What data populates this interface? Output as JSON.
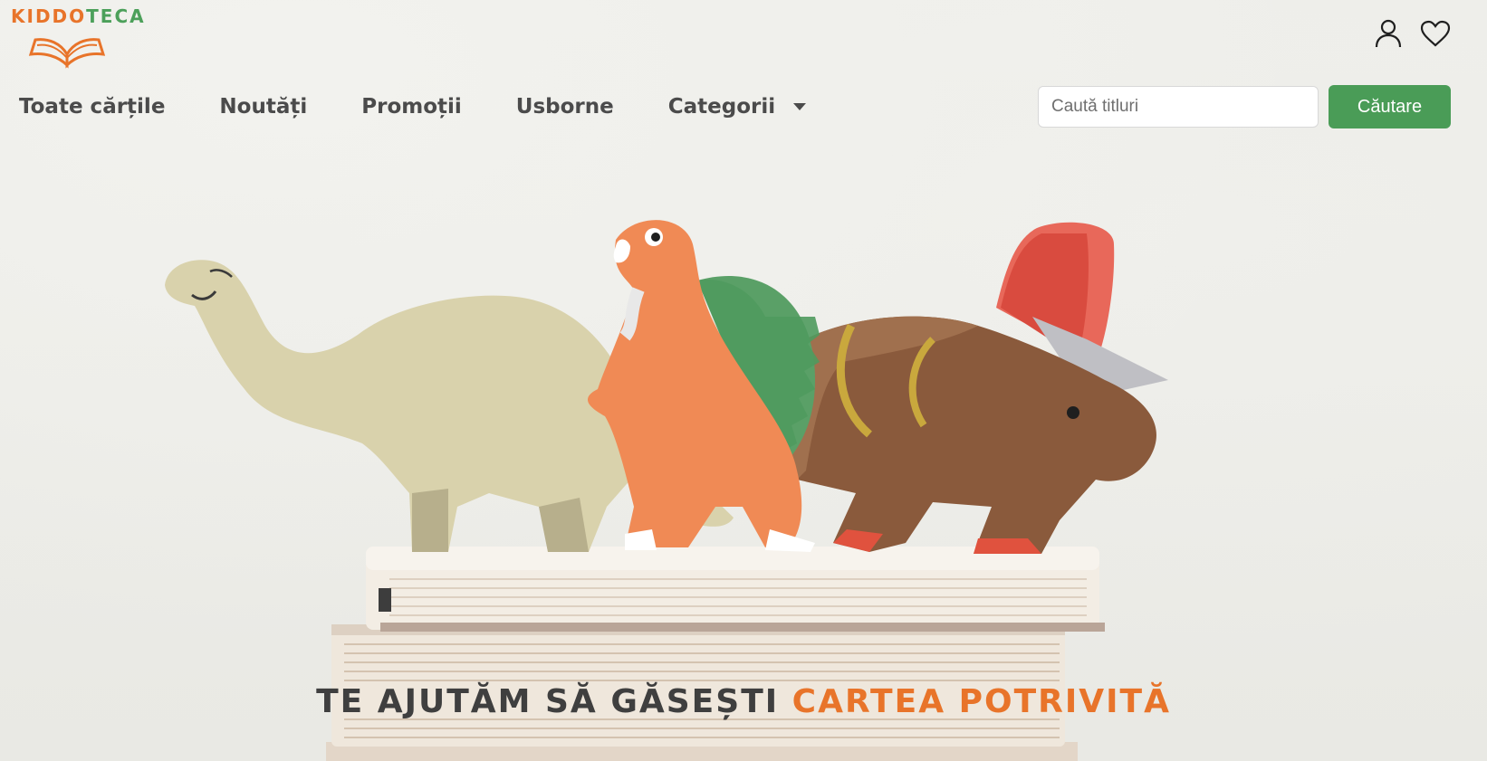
{
  "brand": {
    "name_part1": "KIDDO",
    "name_part2": "TECA",
    "color_orange": "#e8742a",
    "color_green": "#4ca05a",
    "logo_icon": "open-book-icon"
  },
  "header": {
    "icons": [
      "user-icon",
      "heart-icon"
    ]
  },
  "nav": {
    "items": [
      {
        "label": "Toate cărțile"
      },
      {
        "label": "Noutăți"
      },
      {
        "label": "Promoții"
      },
      {
        "label": "Usborne"
      },
      {
        "label": "Categorii"
      }
    ]
  },
  "search": {
    "placeholder": "Caută titluri",
    "value": "",
    "button_label": "Căutare",
    "button_color": "#4a9c57"
  },
  "hero": {
    "tagline_part1": "TE AJUTĂM SĂ GĂSEȘTI ",
    "tagline_part2": "CARTEA POTRIVITĂ",
    "image": "wooden-dinosaur-toys-on-books"
  }
}
